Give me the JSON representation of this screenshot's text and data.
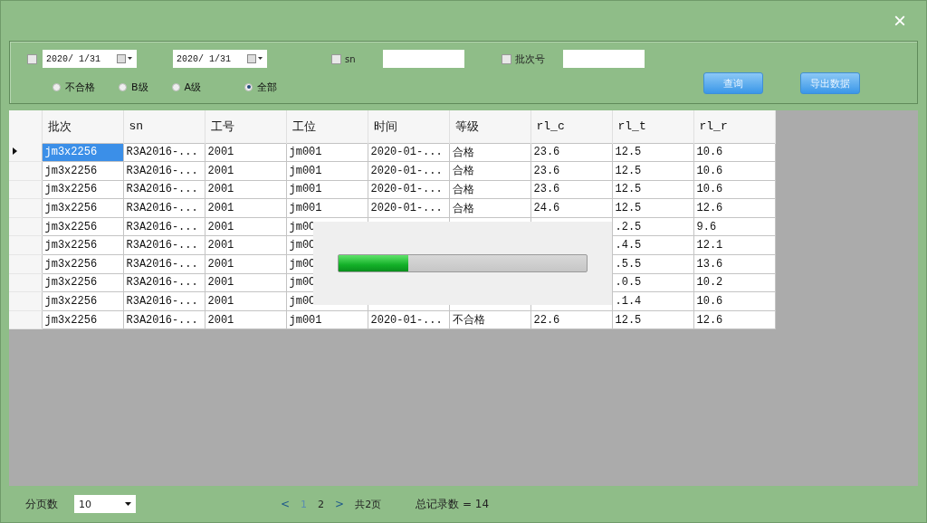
{
  "window": {
    "close": "×"
  },
  "filters": {
    "date_enabled": false,
    "date_from": "2020/ 1/31",
    "date_to": "2020/ 1/31",
    "sn": {
      "label": "sn",
      "checked": false
    },
    "batch": {
      "label": "批次号",
      "checked": false
    },
    "grades": [
      {
        "label": "不合格",
        "selected": false
      },
      {
        "label": "B级",
        "selected": false
      },
      {
        "label": "A级",
        "selected": false
      },
      {
        "label": "全部",
        "selected": true
      }
    ],
    "buttons": [
      "查询",
      "导出数据"
    ]
  },
  "table": {
    "columns": [
      "批次",
      "sn",
      "工号",
      "工位",
      "时间",
      "等级",
      "rl_c",
      "rl_t",
      "rl_r"
    ],
    "rows": [
      {
        "selected": true,
        "cells": [
          "jm3x2256",
          "R3A2016-...",
          "2001",
          "jm001",
          "2020-01-...",
          "合格",
          "23.6",
          "12.5",
          "10.6"
        ]
      },
      {
        "selected": false,
        "cells": [
          "jm3x2256",
          "R3A2016-...",
          "2001",
          "jm001",
          "2020-01-...",
          "合格",
          "23.6",
          "12.5",
          "10.6"
        ]
      },
      {
        "selected": false,
        "cells": [
          "jm3x2256",
          "R3A2016-...",
          "2001",
          "jm001",
          "2020-01-...",
          "合格",
          "23.6",
          "12.5",
          "10.6"
        ]
      },
      {
        "selected": false,
        "cells": [
          "jm3x2256",
          "R3A2016-...",
          "2001",
          "jm001",
          "2020-01-...",
          "合格",
          "24.6",
          "12.5",
          "12.6"
        ]
      },
      {
        "selected": false,
        "cells": [
          "jm3x2256",
          "R3A2016-...",
          "2001",
          "jm0C",
          null,
          null,
          null,
          ".2.5",
          "9.6"
        ]
      },
      {
        "selected": false,
        "cells": [
          "jm3x2256",
          "R3A2016-...",
          "2001",
          "jm0C",
          null,
          null,
          null,
          ".4.5",
          "12.1"
        ]
      },
      {
        "selected": false,
        "cells": [
          "jm3x2256",
          "R3A2016-...",
          "2001",
          "jm0C",
          null,
          null,
          null,
          ".5.5",
          "13.6"
        ]
      },
      {
        "selected": false,
        "cells": [
          "jm3x2256",
          "R3A2016-...",
          "2001",
          "jm0C",
          null,
          null,
          null,
          ".0.5",
          "10.2"
        ]
      },
      {
        "selected": false,
        "cells": [
          "jm3x2256",
          "R3A2016-...",
          "2001",
          "jm0C",
          null,
          null,
          null,
          ".1.4",
          "10.6"
        ]
      },
      {
        "selected": false,
        "cells": [
          "jm3x2256",
          "R3A2016-...",
          "2001",
          "jm001",
          "2020-01-...",
          "不合格",
          "22.6",
          "12.5",
          "12.6"
        ]
      }
    ]
  },
  "progress_dialog": {
    "level": 0.28
  },
  "footer": {
    "page_size_label": "分页数",
    "page_size": "10",
    "pager": {
      "prev": "<",
      "pages": [
        {
          "label": "1",
          "selected": true
        },
        {
          "label": "2",
          "selected": false
        }
      ],
      "next": ">",
      "total_pages": "共2页"
    },
    "total_records": "总记录数 = 14"
  }
}
